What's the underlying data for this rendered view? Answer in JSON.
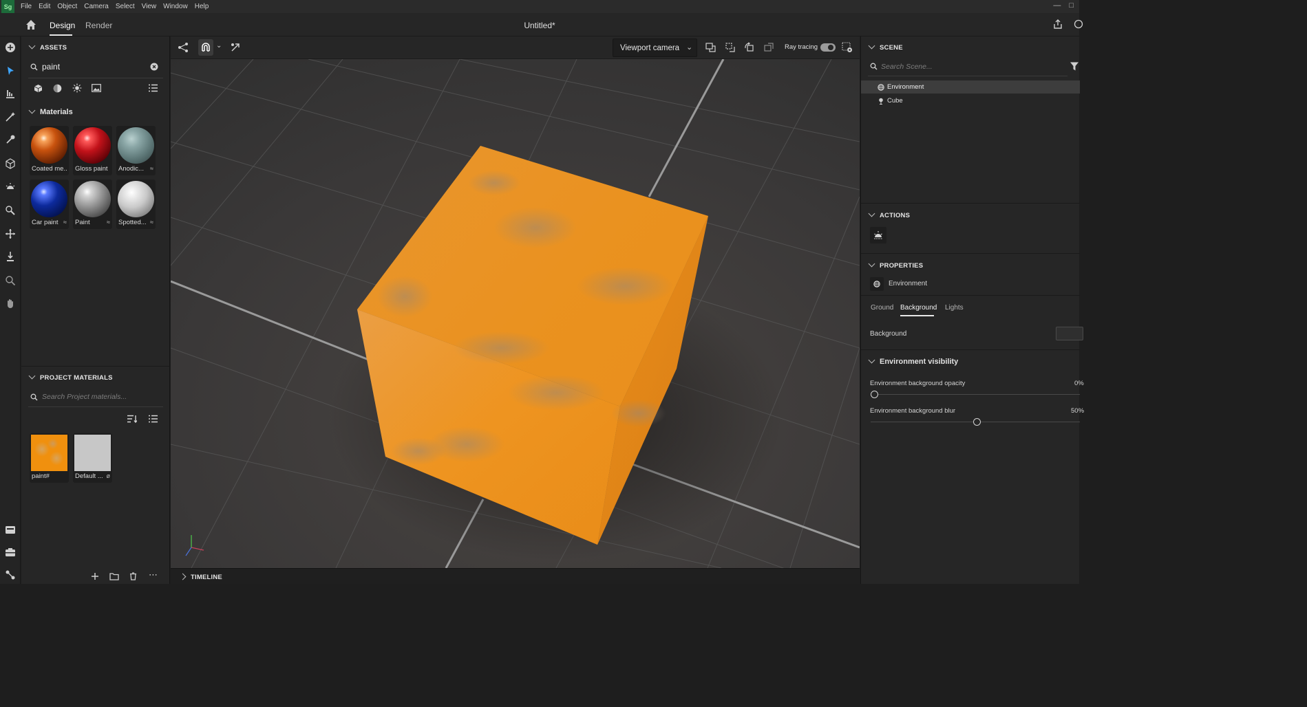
{
  "app": {
    "logo_text": "Sg",
    "title": "Untitled*"
  },
  "menu": [
    "File",
    "Edit",
    "Object",
    "Camera",
    "Select",
    "View",
    "Window",
    "Help"
  ],
  "modes": {
    "design": "Design",
    "render": "Render"
  },
  "assets": {
    "title": "ASSETS",
    "search_value": "paint",
    "materials_title": "Materials",
    "materials": [
      {
        "label": "Coated me...",
        "badge": "",
        "color": "#c8520e"
      },
      {
        "label": "Gloss paint",
        "badge": "",
        "color": "#c2121a"
      },
      {
        "label": "Anodic...",
        "badge": "≈",
        "color": "#6e8a8a"
      },
      {
        "label": "Car paint",
        "badge": "≈",
        "color": "#0d2a9c"
      },
      {
        "label": "Paint",
        "badge": "≈",
        "color": "#9a9a9a"
      },
      {
        "label": "Spotted...",
        "badge": "≈",
        "color": "#c9c9c9"
      }
    ]
  },
  "project_materials": {
    "title": "PROJECT MATERIALS",
    "search_placeholder": "Search Project materials...",
    "items": [
      {
        "label": "paint#",
        "badge": ""
      },
      {
        "label": "Default ...",
        "badge": "ø"
      }
    ]
  },
  "viewport_toolbar": {
    "camera": "Viewport camera",
    "ray_tracing": "Ray tracing"
  },
  "timeline": {
    "title": "TIMELINE"
  },
  "scene": {
    "title": "SCENE",
    "search_placeholder": "Search Scene...",
    "items": [
      "Environment",
      "Cube"
    ]
  },
  "actions": {
    "title": "ACTIONS"
  },
  "properties": {
    "title": "PROPERTIES",
    "object": "Environment",
    "tabs": [
      "Ground",
      "Background",
      "Lights"
    ],
    "active_tab": "Background",
    "background_label": "Background",
    "env_visibility_title": "Environment visibility",
    "opacity_label": "Environment background opacity",
    "opacity_value": "0%",
    "opacity": 0,
    "blur_label": "Environment background blur",
    "blur_value": "50%",
    "blur": 0.5
  },
  "colors": {
    "accent": "#e8e8e8",
    "cube": "#e88a16",
    "selected_row": "#3d3d3d"
  }
}
